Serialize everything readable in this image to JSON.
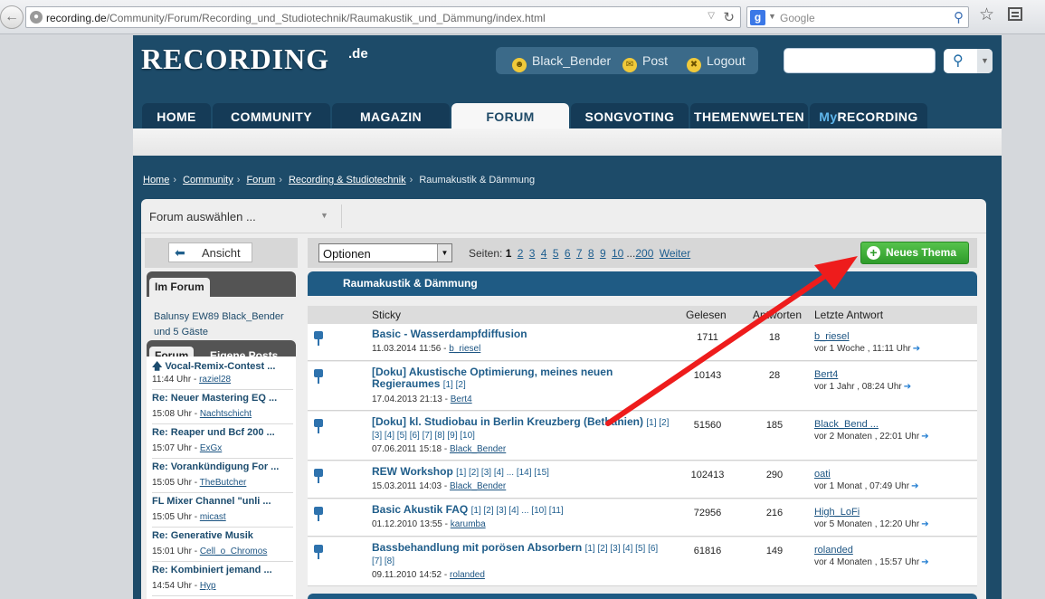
{
  "browser": {
    "url_domain": "recording.de",
    "url_path": "/Community/Forum/Recording_und_Studiotechnik/Raumakustik_und_Dämmung/index.html",
    "search_placeholder": "Google"
  },
  "site": {
    "logo": "RECORDING",
    "logo_suffix": ".de",
    "user": {
      "name": "Black_Bender",
      "post": "Post",
      "logout": "Logout"
    },
    "nav": [
      {
        "label": "HOME"
      },
      {
        "label": "COMMUNITY"
      },
      {
        "label": "MAGAZIN"
      },
      {
        "label": "FORUM",
        "active": true
      },
      {
        "label": "SONGVOTING"
      },
      {
        "label": "THEMENWELTEN"
      },
      {
        "label_prefix": "My",
        "label": "RECORDING"
      }
    ]
  },
  "breadcrumb": [
    "Home",
    "Community",
    "Forum",
    "Recording & Studiotechnik",
    "Raumakustik & Dämmung"
  ],
  "forum_select": "Forum auswählen ...",
  "sidebar": {
    "ansicht": "Ansicht",
    "im_forum_tab": "Im Forum",
    "online_line1": "Balunsy EW89 Black_Bender",
    "online_line2": "und 5 Gäste",
    "tab_forum": "Forum",
    "tab_eigene": "Eigene Posts",
    "posts": [
      {
        "title": "Vocal-Remix-Contest ...",
        "time": "11:44 Uhr",
        "user": "raziel28",
        "pinned": true
      },
      {
        "title": "Re: Neuer Mastering EQ ...",
        "time": "15:08 Uhr",
        "user": "Nachtschicht"
      },
      {
        "title": "Re: Reaper und Bcf 200 ...",
        "time": "15:07 Uhr",
        "user": "ExGx"
      },
      {
        "title": "Re: Vorankündigung For ...",
        "time": "15:05 Uhr",
        "user": "TheButcher"
      },
      {
        "title": "FL Mixer Channel \"unli ...",
        "time": "15:05 Uhr",
        "user": "micast"
      },
      {
        "title": "Re: Generative Musik",
        "time": "15:01 Uhr",
        "user": "Cell_o_Chromos"
      },
      {
        "title": "Re: Kombiniert jemand ...",
        "time": "14:54 Uhr",
        "user": "Hyp"
      }
    ]
  },
  "toolbar": {
    "options": "Optionen",
    "pages_label": "Seiten:",
    "current_page": "1",
    "pages": [
      "2",
      "3",
      "4",
      "5",
      "6",
      "7",
      "8",
      "9",
      "10"
    ],
    "ellipsis": "...",
    "last_page": "200",
    "next": "Weiter",
    "new_topic": "Neues Thema"
  },
  "forum_title": "Raumakustik & Dämmung",
  "table_headers": {
    "sticky": "Sticky",
    "views": "Gelesen",
    "replies": "Antworten",
    "last_reply": "Letzte Antwort"
  },
  "topics": [
    {
      "title": "Basic - Wasserdampfdiffusion",
      "pages": "",
      "date": "11.03.2014 11:56",
      "author": "b_riesel",
      "views": "1711",
      "replies": "18",
      "last_user": "b_riesel",
      "last_time": "vor 1 Woche , 11:11 Uhr"
    },
    {
      "title": "[Doku] Akustische Optimierung, meines neuen Regieraumes",
      "pages": "[1] [2]",
      "date": "17.04.2013 21:13",
      "author": "Bert4",
      "views": "10143",
      "replies": "28",
      "last_user": "Bert4",
      "last_time": "vor 1 Jahr , 08:24 Uhr"
    },
    {
      "title": "[Doku] kl. Studiobau in Berlin Kreuzberg (Bethanien)",
      "pages": "[1] [2] [3] [4] [5] [6] [7] [8] [9] [10]",
      "date": "07.06.2011 15:18",
      "author": "Black_Bender",
      "views": "51560",
      "replies": "185",
      "last_user": "Black_Bend ...",
      "last_time": "vor 2 Monaten , 22:01 Uhr"
    },
    {
      "title": "REW Workshop",
      "pages": "[1] [2] [3] [4] ... [14] [15]",
      "date": "15.03.2011 14:03",
      "author": "Black_Bender",
      "views": "102413",
      "replies": "290",
      "last_user": "oati",
      "last_time": "vor 1 Monat , 07:49 Uhr"
    },
    {
      "title": "Basic Akustik FAQ",
      "pages": "[1] [2] [3] [4] ... [10] [11]",
      "date": "01.12.2010 13:55",
      "author": "karumba",
      "views": "72956",
      "replies": "216",
      "last_user": "High_LoFi",
      "last_time": "vor 5 Monaten , 12:20 Uhr"
    },
    {
      "title": "Bassbehandlung mit porösen Absorbern",
      "pages": "[1] [2] [3] [4] [5] [6] [7] [8]",
      "date": "09.11.2010 14:52",
      "author": "rolanded",
      "views": "61816",
      "replies": "149",
      "last_user": "rolanded",
      "last_time": "vor 4 Monaten , 15:57 Uhr"
    }
  ],
  "colors": {
    "site_bg": "#1d4b69",
    "accent_green": "#2f9b2b",
    "link": "#1f5d8a",
    "annotation_arrow": "#ee1c1c"
  }
}
